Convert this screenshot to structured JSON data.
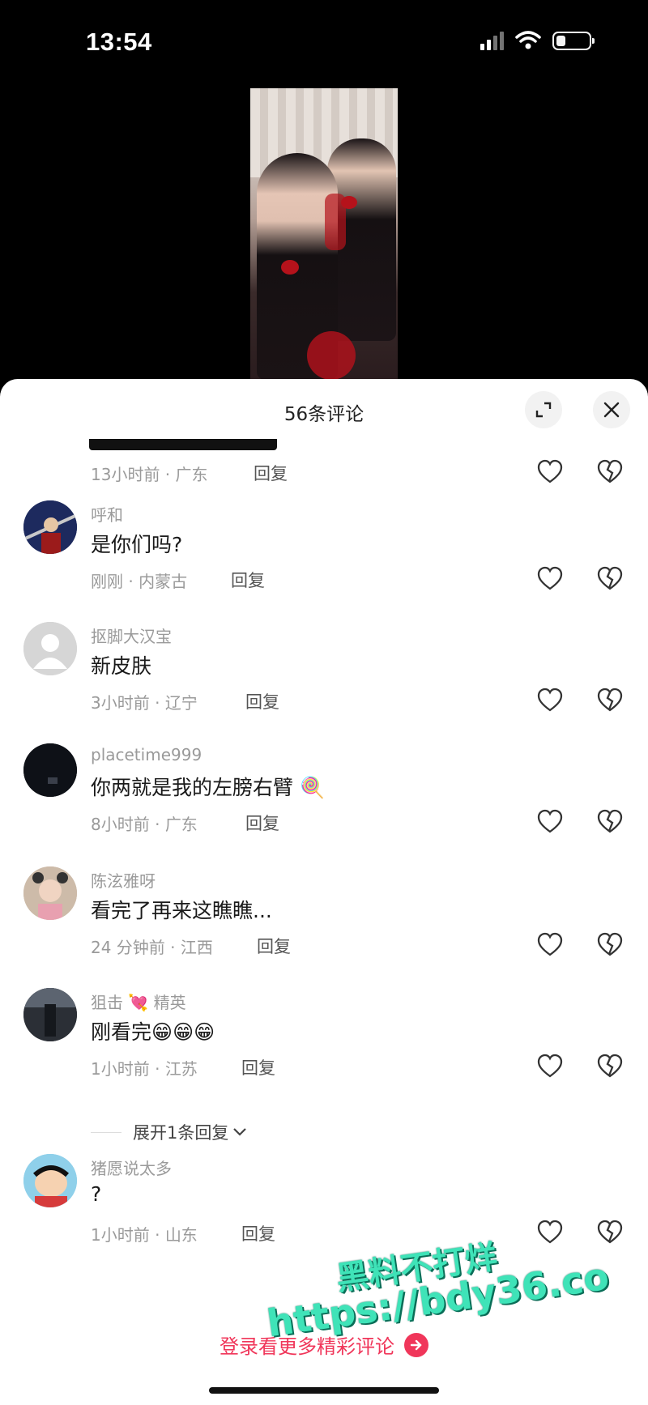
{
  "status": {
    "time": "13:54"
  },
  "colors": {
    "accent": "#f0365a",
    "watermark": "#3fe3b8"
  },
  "sheet": {
    "title": "56条评论",
    "expand_icon": "expand-icon",
    "close_icon": "close-icon"
  },
  "comments": [
    {
      "user": "",
      "text": "",
      "time": "13小时前",
      "location": "广东",
      "reply": "回复",
      "avatar_icon": ""
    },
    {
      "user": "呼和",
      "text": "是你们吗?",
      "time": "刚刚",
      "location": "内蒙古",
      "reply": "回复",
      "avatar_icon": "anime-avatar"
    },
    {
      "user": "抠脚大汉宝",
      "text": "新皮肤",
      "time": "3小时前",
      "location": "辽宁",
      "reply": "回复",
      "avatar_icon": "default-avatar"
    },
    {
      "user": "placetime999",
      "text": "你两就是我的左膀右臂",
      "emoji": "🍭",
      "time": "8小时前",
      "location": "广东",
      "reply": "回复",
      "avatar_icon": "dark-avatar"
    },
    {
      "user": "陈泫雅呀",
      "text": "看完了再来这瞧瞧...",
      "time": "24 分钟前",
      "location": "江西",
      "reply": "回复",
      "avatar_icon": "child-avatar"
    },
    {
      "user": "狙击",
      "user_emoji": "💘",
      "user_suffix": "精英",
      "text": "刚看完",
      "emoji": "😁😁😁",
      "time": "1小时前",
      "location": "江苏",
      "reply": "回复",
      "avatar_icon": "photo-avatar"
    },
    {
      "user": "猪愿说太多",
      "text": "?",
      "time": "1小时前",
      "location": "山东",
      "reply": "回复",
      "avatar_icon": "cartoon-avatar"
    }
  ],
  "expand_replies": "展开1条回复",
  "login_prompt": "登录看更多精彩评论",
  "watermark": {
    "line1": "黑料不打烊",
    "line2": "https://bdy36.co"
  }
}
